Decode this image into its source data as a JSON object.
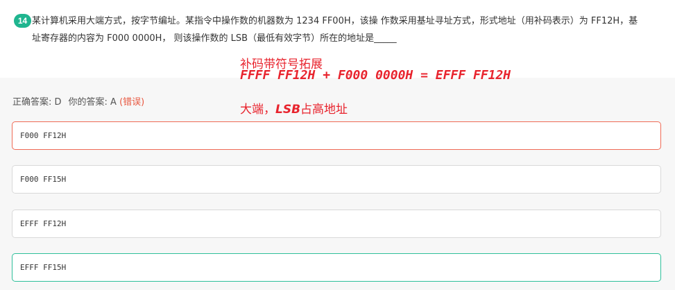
{
  "question": {
    "number": "14",
    "text": "某计算机采用大端方式，按字节编址。某指令中操作数的机器数为 1234 FF00H，该操 作数采用基址寻址方式，形式地址（用补码表示）为 FF12H，基址寄存器的内容为 F000 0000H， 则该操作数的 LSB（最低有效字节）所在的地址是_____"
  },
  "annotations": {
    "line1": "补码带符号拓展",
    "line2": "FFFF FF12H + F000 0000H = EFFF FF12H",
    "line3_prefix": "大端，",
    "line3_em": "LSB",
    "line3_suffix": "占高地址"
  },
  "result": {
    "correct_label": "正确答案: D",
    "your_label": "你的答案: A",
    "status": "(错误)"
  },
  "options": [
    {
      "text": "F000 FF12H",
      "state": "wrong"
    },
    {
      "text": "F000 FF15H",
      "state": "normal"
    },
    {
      "text": "EFFF FF12H",
      "state": "normal"
    },
    {
      "text": "EFFF FF15H",
      "state": "correct"
    }
  ],
  "colors": {
    "badge": "#1fb58f",
    "annotation": "#e8232d",
    "wrong_border": "#ef6a55",
    "correct_border": "#2ebf9a",
    "wrong_text": "#e8573f"
  }
}
